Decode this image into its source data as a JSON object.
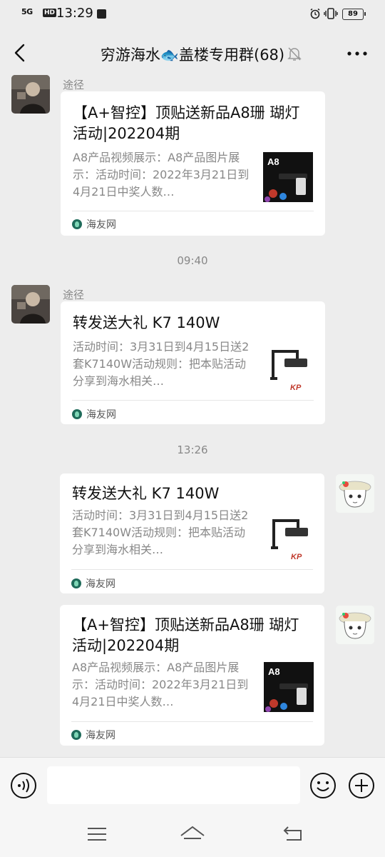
{
  "status_bar": {
    "signal": "5G",
    "hd": "HD",
    "time": "13:29",
    "battery": "89"
  },
  "header": {
    "title": "穷游海水🐟盖楼专用群(68)"
  },
  "messages": [
    {
      "sender": "途径",
      "card": {
        "title": "【A+智控】顶贴送新品A8珊 瑚灯活动|202204期",
        "desc": "A8产品视频展示：A8产品图片展示：活动时间：2022年3月21日到4月21日中奖人数…",
        "source": "海友网",
        "thumb_label": "A8"
      }
    },
    {
      "sender": "途径",
      "card": {
        "title": "转发送大礼 K7 140W",
        "desc": "活动时间：3月31日到4月15日送2套K7140W活动规则：把本贴活动分享到海水相关…",
        "source": "海友网",
        "thumb_label": "KP"
      }
    },
    {
      "card": {
        "title": "转发送大礼 K7 140W",
        "desc": "活动时间：3月31日到4月15日送2套K7140W活动规则：把本贴活动分享到海水相关…",
        "source": "海友网",
        "thumb_label": "KP"
      }
    },
    {
      "card": {
        "title": "【A+智控】顶贴送新品A8珊 瑚灯活动|202204期",
        "desc": "A8产品视频展示：A8产品图片展示：活动时间：2022年3月21日到4月21日中奖人数…",
        "source": "海友网",
        "thumb_label": "A8"
      }
    }
  ],
  "timestamps": [
    "09:40",
    "13:26"
  ],
  "input_bar": {
    "text": ""
  },
  "icons": {
    "back": "back-arrow-icon",
    "mute": "mute-bell-icon",
    "more": "more-icon",
    "voice": "voice-icon",
    "emoji": "emoji-icon",
    "plus": "plus-icon"
  }
}
